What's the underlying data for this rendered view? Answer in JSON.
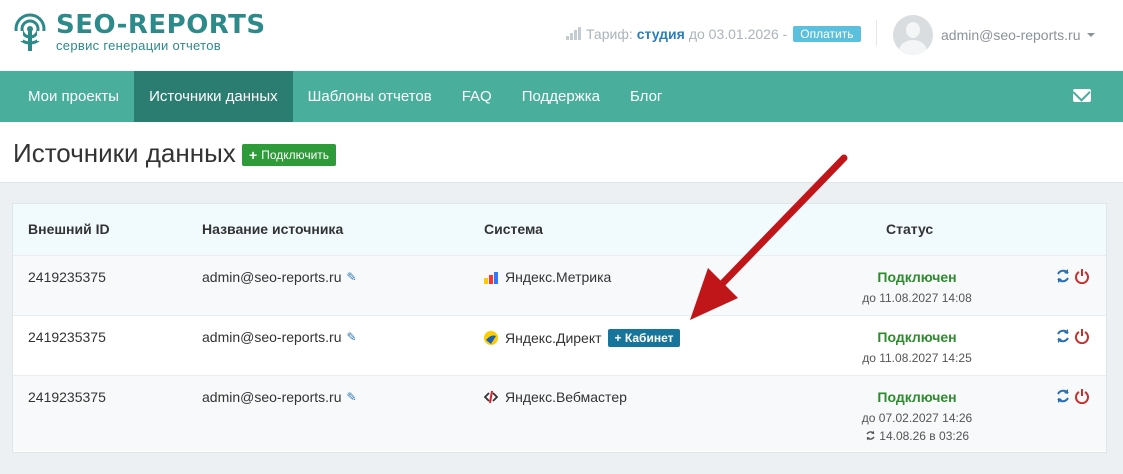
{
  "header": {
    "logo_title": "SEO-REPORTS",
    "logo_subtitle": "сервис генерации отчетов",
    "tariff_label": "Тариф:",
    "tariff_plan": "студия",
    "tariff_until": "до 03.01.2026 -",
    "pay_button": "Оплатить",
    "user_email": "admin@seo-reports.ru"
  },
  "nav": {
    "items": [
      "Мои проекты",
      "Источники данных",
      "Шаблоны отчетов",
      "FAQ",
      "Поддержка",
      "Блог"
    ],
    "active_index": 1
  },
  "page": {
    "title": "Источники данных",
    "connect_button": "Подключить"
  },
  "table": {
    "headers": [
      "Внешний ID",
      "Название источника",
      "Система",
      "Статус"
    ],
    "rows": [
      {
        "id": "2419235375",
        "name": "admin@seo-reports.ru",
        "system": "Яндекс.Метрика",
        "status": "Подключен",
        "until": "до 11.08.2027 14:08"
      },
      {
        "id": "2419235375",
        "name": "admin@seo-reports.ru",
        "system": "Яндекс.Директ",
        "cabinet_button": "+ Кабинет",
        "status": "Подключен",
        "until": "до 11.08.2027 14:25"
      },
      {
        "id": "2419235375",
        "name": "admin@seo-reports.ru",
        "system": "Яндекс.Вебмастер",
        "status": "Подключен",
        "until": "до 07.02.2027 14:26",
        "synced": "14.08.26 в 03:26"
      }
    ]
  },
  "colors": {
    "brand": "#2d8a8a",
    "nav": "#4aae9d",
    "nav_active": "#2c7d71",
    "status_ok": "#2e8b2e",
    "arrow": "#c0161a"
  }
}
